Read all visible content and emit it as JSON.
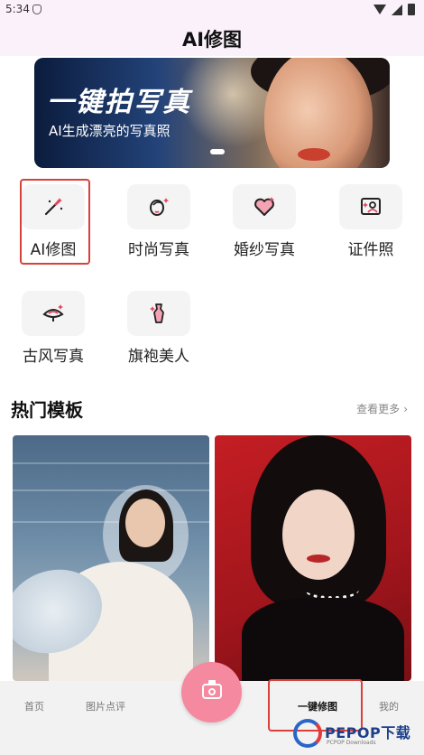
{
  "status_bar": {
    "time": "5:34"
  },
  "header": {
    "title": "AI修图"
  },
  "banner": {
    "title": "一键拍写真",
    "subtitle": "AI生成漂亮的写真照"
  },
  "features": [
    {
      "label": "AI修图",
      "icon": "magic-wand-icon"
    },
    {
      "label": "时尚写真",
      "icon": "face-sparkle-icon"
    },
    {
      "label": "婚纱写真",
      "icon": "heart-icon"
    },
    {
      "label": "证件照",
      "icon": "id-photo-icon"
    },
    {
      "label": "古风写真",
      "icon": "fan-icon"
    },
    {
      "label": "旗袍美人",
      "icon": "qipao-icon"
    }
  ],
  "section": {
    "title": "热门模板",
    "more": "查看更多"
  },
  "bottom_nav": {
    "items": [
      {
        "label": "首页"
      },
      {
        "label": "图片点评"
      },
      {
        "label": "一键修图"
      },
      {
        "label": "我的"
      }
    ]
  },
  "watermark": {
    "text": "PEPOP下载",
    "sub": "PCPOP Downloads"
  },
  "colors": {
    "accent_pink": "#f5899f",
    "highlight_red": "#d9403a",
    "header_bg": "#fbf1fb"
  }
}
